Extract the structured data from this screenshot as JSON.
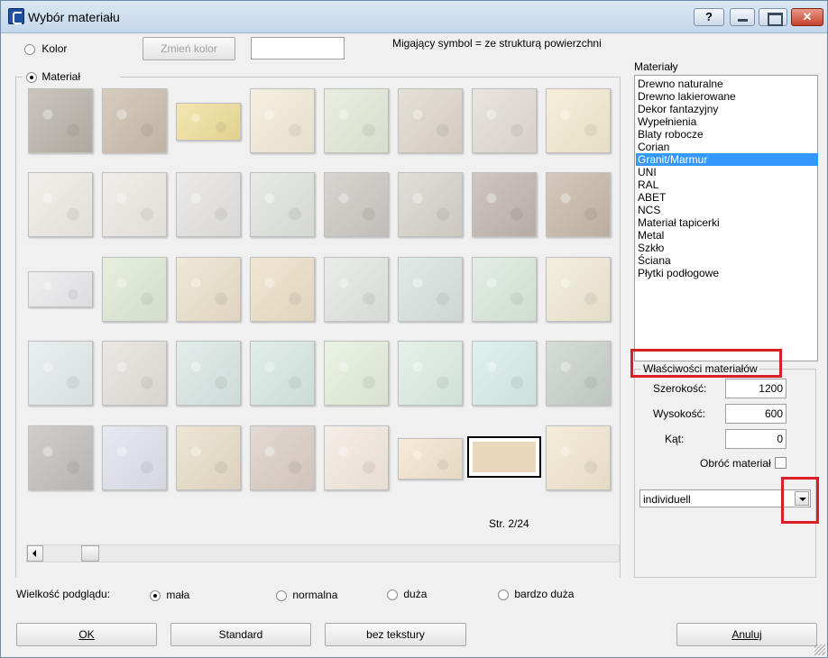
{
  "window": {
    "title": "Wybór materiału",
    "help_label": "?"
  },
  "top": {
    "kolor_label": "Kolor",
    "change_color_label": "Zmień kolor",
    "blink_note": "Migający symbol = ze strukturą powierzchni",
    "material_label": "Materiał"
  },
  "materials_list": {
    "header": "Materiały",
    "items": [
      "Drewno naturalne",
      "Drewno lakierowane",
      "Dekor fantazyjny",
      "Wypełnienia",
      "Blaty robocze",
      "Corian",
      "Granit/Marmur",
      "UNI",
      "RAL",
      "ABET",
      "NCS",
      "Materiał tapicerki",
      "Metal",
      "Szkło",
      "Ściana",
      "Płytki podłogowe"
    ],
    "selected": "Granit/Marmur"
  },
  "properties": {
    "group_label": "Właściwości materiałów",
    "width_label": "Szerokość:",
    "width_value": "1200",
    "height_label": "Wysokość:",
    "height_value": "600",
    "angle_label": "Kąt:",
    "angle_value": "0",
    "rotate_label": "Obróć materiał",
    "mode_value": "individuell"
  },
  "swatches": {
    "page_label": "Str. 2/24",
    "tiles": [
      {
        "name": "granite-grey",
        "color": "#b8b2a8"
      },
      {
        "name": "granite-beige",
        "color": "#c9bcaa"
      },
      {
        "name": "yellow-plain",
        "color": "#eedd98"
      },
      {
        "name": "cream-speckled",
        "color": "#f1ead7"
      },
      {
        "name": "pale-green-speckled",
        "color": "#e3e8d7"
      },
      {
        "name": "warm-grey",
        "color": "#dcd5ca"
      },
      {
        "name": "light-taupe",
        "color": "#e2dbd4"
      },
      {
        "name": "pale-yellow-marble",
        "color": "#f3e9cf"
      },
      {
        "name": "white-speckled",
        "color": "#eeeae5"
      },
      {
        "name": "off-white",
        "color": "#ece8e3"
      },
      {
        "name": "grey-white-speckled",
        "color": "#e4e3e1"
      },
      {
        "name": "grey-green-veined",
        "color": "#dfe3dc"
      },
      {
        "name": "dark-speckled",
        "color": "#cbc7c2"
      },
      {
        "name": "grey-beige-stone",
        "color": "#d7d2cb"
      },
      {
        "name": "pink-granite",
        "color": "#c0b4ad"
      },
      {
        "name": "brown-granite",
        "color": "#c6b7a7"
      },
      {
        "name": "white-marble-slab",
        "color": "#e9e9eb"
      },
      {
        "name": "mint-veined",
        "color": "#dfe9d5"
      },
      {
        "name": "beige-marble",
        "color": "#eadfca"
      },
      {
        "name": "sand-marble",
        "color": "#ebdfc5"
      },
      {
        "name": "light-grey-plain",
        "color": "#e2e5e1"
      },
      {
        "name": "blue-green-marble",
        "color": "#d7e2dd"
      },
      {
        "name": "green-veined-marble",
        "color": "#d9e8dc"
      },
      {
        "name": "cream-crackle",
        "color": "#efe9d3"
      },
      {
        "name": "white-dots",
        "color": "#e2eae9"
      },
      {
        "name": "stone-grey",
        "color": "#e4dfd9"
      },
      {
        "name": "aqua-veined",
        "color": "#d9e6e3"
      },
      {
        "name": "aqua-mottled",
        "color": "#d7e7e1"
      },
      {
        "name": "pale-green",
        "color": "#e4eedb"
      },
      {
        "name": "mint-green",
        "color": "#dcece2"
      },
      {
        "name": "aqua-light",
        "color": "#d6ece7"
      },
      {
        "name": "grey-green-crackle",
        "color": "#c8d0ca"
      },
      {
        "name": "grey-slate",
        "color": "#c0bebb"
      },
      {
        "name": "blue-white-speckled",
        "color": "#dfe1ec"
      },
      {
        "name": "beige-veined",
        "color": "#e7dcc7"
      },
      {
        "name": "rose-veined",
        "color": "#dacdc4"
      },
      {
        "name": "peach-light",
        "color": "#f2e8de"
      },
      {
        "name": "cream-slab",
        "color": "#f2e4cc"
      },
      {
        "name": "sand-slab-selected",
        "color": "#e8d6bd"
      },
      {
        "name": "ivory-crackle",
        "color": "#f1e6cf"
      }
    ]
  },
  "preview_size": {
    "label": "Wielkość podglądu:",
    "options": [
      "mała",
      "normalna",
      "duża",
      "bardzo duża"
    ],
    "selected": "mała"
  },
  "footer": {
    "ok_label": "OK",
    "standard_label": "Standard",
    "no_texture_label": "bez tekstury",
    "cancel_label": "Anuluj"
  }
}
